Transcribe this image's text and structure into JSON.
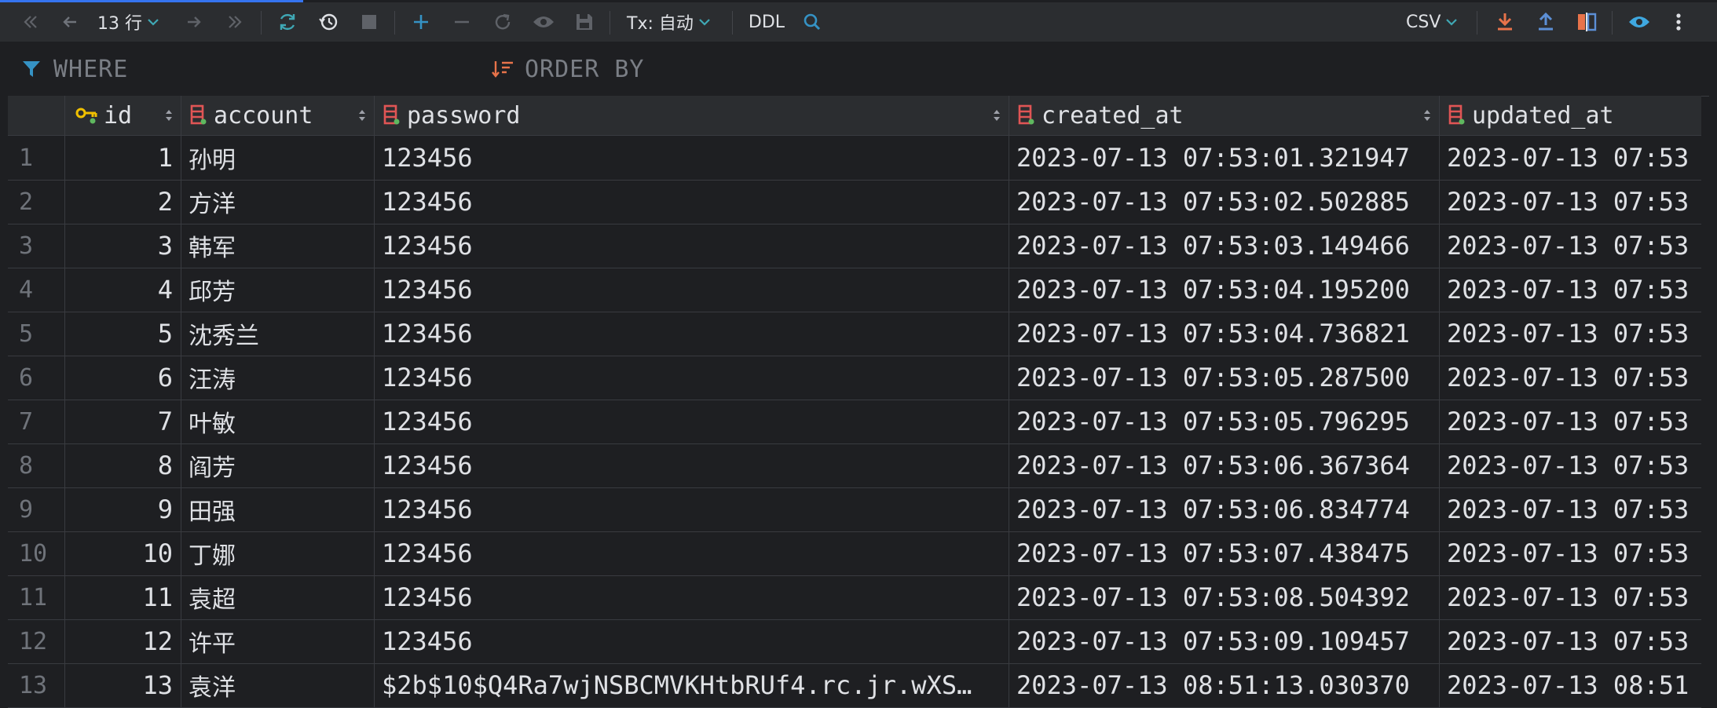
{
  "toolbar": {
    "rows_label": "13 行",
    "tx_label": "Tx: 自动",
    "ddl_label": "DDL",
    "export_format": "CSV"
  },
  "filter": {
    "where_label": "WHERE",
    "order_by_label": "ORDER BY"
  },
  "columns": [
    {
      "name": "id",
      "icon": "primary-key-icon"
    },
    {
      "name": "account",
      "icon": "column-icon"
    },
    {
      "name": "password",
      "icon": "column-icon"
    },
    {
      "name": "created_at",
      "icon": "column-icon"
    },
    {
      "name": "updated_at",
      "icon": "column-icon"
    }
  ],
  "rows": [
    {
      "num": "1",
      "id": "1",
      "account": "孙明",
      "password": "123456",
      "created_at": "2023-07-13 07:53:01.321947",
      "updated_at": "2023-07-13 07:53"
    },
    {
      "num": "2",
      "id": "2",
      "account": "方洋",
      "password": "123456",
      "created_at": "2023-07-13 07:53:02.502885",
      "updated_at": "2023-07-13 07:53"
    },
    {
      "num": "3",
      "id": "3",
      "account": "韩军",
      "password": "123456",
      "created_at": "2023-07-13 07:53:03.149466",
      "updated_at": "2023-07-13 07:53"
    },
    {
      "num": "4",
      "id": "4",
      "account": "邱芳",
      "password": "123456",
      "created_at": "2023-07-13 07:53:04.195200",
      "updated_at": "2023-07-13 07:53"
    },
    {
      "num": "5",
      "id": "5",
      "account": "沈秀兰",
      "password": "123456",
      "created_at": "2023-07-13 07:53:04.736821",
      "updated_at": "2023-07-13 07:53"
    },
    {
      "num": "6",
      "id": "6",
      "account": "汪涛",
      "password": "123456",
      "created_at": "2023-07-13 07:53:05.287500",
      "updated_at": "2023-07-13 07:53"
    },
    {
      "num": "7",
      "id": "7",
      "account": "叶敏",
      "password": "123456",
      "created_at": "2023-07-13 07:53:05.796295",
      "updated_at": "2023-07-13 07:53"
    },
    {
      "num": "8",
      "id": "8",
      "account": "阎芳",
      "password": "123456",
      "created_at": "2023-07-13 07:53:06.367364",
      "updated_at": "2023-07-13 07:53"
    },
    {
      "num": "9",
      "id": "9",
      "account": "田强",
      "password": "123456",
      "created_at": "2023-07-13 07:53:06.834774",
      "updated_at": "2023-07-13 07:53"
    },
    {
      "num": "10",
      "id": "10",
      "account": "丁娜",
      "password": "123456",
      "created_at": "2023-07-13 07:53:07.438475",
      "updated_at": "2023-07-13 07:53"
    },
    {
      "num": "11",
      "id": "11",
      "account": "袁超",
      "password": "123456",
      "created_at": "2023-07-13 07:53:08.504392",
      "updated_at": "2023-07-13 07:53"
    },
    {
      "num": "12",
      "id": "12",
      "account": "许平",
      "password": "123456",
      "created_at": "2023-07-13 07:53:09.109457",
      "updated_at": "2023-07-13 07:53"
    },
    {
      "num": "13",
      "id": "13",
      "account": "袁洋",
      "password": "$2b$10$Q4Ra7wjNSBCMVKHtbRUf4.rc.jr.wXS…",
      "created_at": "2023-07-13 08:51:13.030370",
      "updated_at": "2023-07-13 08:51"
    }
  ],
  "colors": {
    "accent": "#3574f0",
    "refresh": "#3fa8b5",
    "download": "#e8734a",
    "upload": "#5c8fd6",
    "filter": "#3592c4",
    "key": "#f0c000"
  }
}
